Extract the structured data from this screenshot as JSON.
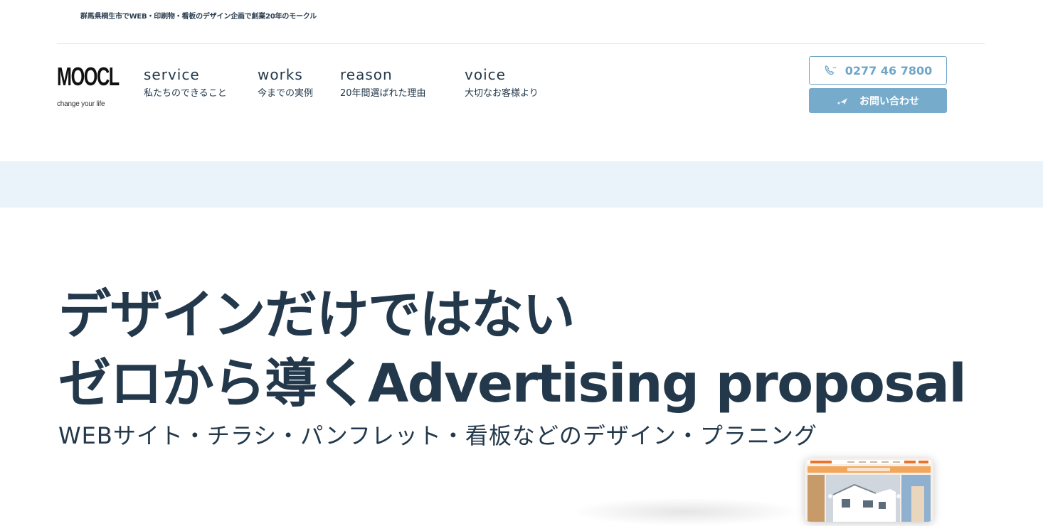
{
  "header": {
    "tagline": "群馬県桐生市でWEB・印刷物・看板のデザイン企画で創業20年のモークル",
    "logo": {
      "word": "MOOCL",
      "sub": "change your life"
    },
    "nav": [
      {
        "en": "service",
        "jp": "私たちのできること"
      },
      {
        "en": "works",
        "jp": "今までの実例"
      },
      {
        "en": "reason",
        "jp": "20年間選ばれた理由"
      },
      {
        "en": "voice",
        "jp": "大切なお客様より"
      }
    ],
    "phone": {
      "number": "0277 46 7800",
      "icon": "phone-icon"
    },
    "contact": {
      "label": "お問い合わせ",
      "icon": "paper-plane-icon"
    }
  },
  "hero": {
    "line1": "デザインだけではない",
    "line2": "ゼロから導くAdvertising proposal",
    "subtitle": "WEBサイト・チラシ・パンフレット・看板などのデザイン・プラニング"
  },
  "colors": {
    "text": "#23394b",
    "accent": "#76abcb",
    "band": "#eaf3fa",
    "preview_orange": "#e8742c"
  }
}
